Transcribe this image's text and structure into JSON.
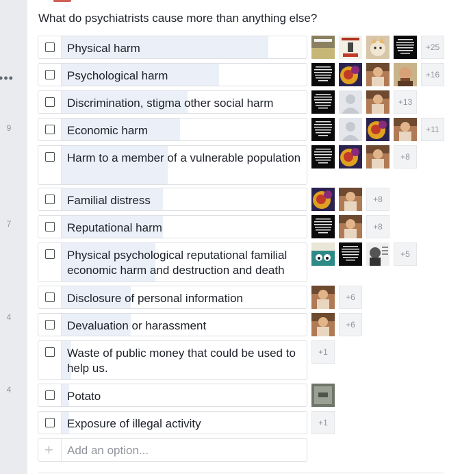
{
  "question": "What do psychiatrists cause more than anything else?",
  "gutter_numbers": [
    "9",
    "7",
    "4",
    "4"
  ],
  "add_option_placeholder": "Add an option...",
  "options": [
    {
      "label": "Physical harm",
      "share": 0.84,
      "voters": [
        "meme-photo",
        "poster",
        "cat",
        "quote"
      ],
      "more": "+25"
    },
    {
      "label": "Psychological harm",
      "share": 0.64,
      "voters": [
        "quote",
        "flower",
        "child",
        "man"
      ],
      "more": "+16"
    },
    {
      "label": "Discrimination, stigma other social harm",
      "share": 0.51,
      "voters": [
        "quote",
        "default",
        "child"
      ],
      "more": "+13"
    },
    {
      "label": "Economic harm",
      "share": 0.48,
      "voters": [
        "quote",
        "default",
        "flower",
        "child"
      ],
      "more": "+11"
    },
    {
      "label": "Harm to a member of a vulnerable population",
      "share": 0.43,
      "voters": [
        "quote",
        "flower",
        "child"
      ],
      "more": "+8"
    },
    {
      "label": "Familial distress",
      "share": 0.41,
      "voters": [
        "flower",
        "child"
      ],
      "more": "+8"
    },
    {
      "label": "Reputational harm",
      "share": 0.41,
      "voters": [
        "quote",
        "child"
      ],
      "more": "+8"
    },
    {
      "label": "Physical psychological reputational familial economic harm and destruction and death",
      "share": 0.38,
      "voters": [
        "monster",
        "quote",
        "portrait"
      ],
      "more": "+5"
    },
    {
      "label": "Disclosure of personal information",
      "share": 0.28,
      "voters": [
        "child"
      ],
      "more": "+6"
    },
    {
      "label": "Devaluation or harassment",
      "share": 0.28,
      "voters": [
        "child"
      ],
      "more": "+6"
    },
    {
      "label": "Waste of public money that could be used to help us.",
      "share": 0.04,
      "voters": [],
      "more": "+1"
    },
    {
      "label": "Potato",
      "share": 0.03,
      "voters": [
        "photo"
      ],
      "more": ""
    },
    {
      "label": "Exposure of illegal activity",
      "share": 0.03,
      "voters": [],
      "more": "+1"
    }
  ],
  "quote_text": "\"When a flower doesn't bloom you fix the environment in which it grows, not the flower\"",
  "colors": {
    "fill": "#ebeff7",
    "border": "#dddfe2",
    "text": "#1d2129",
    "muted": "#90949c"
  }
}
